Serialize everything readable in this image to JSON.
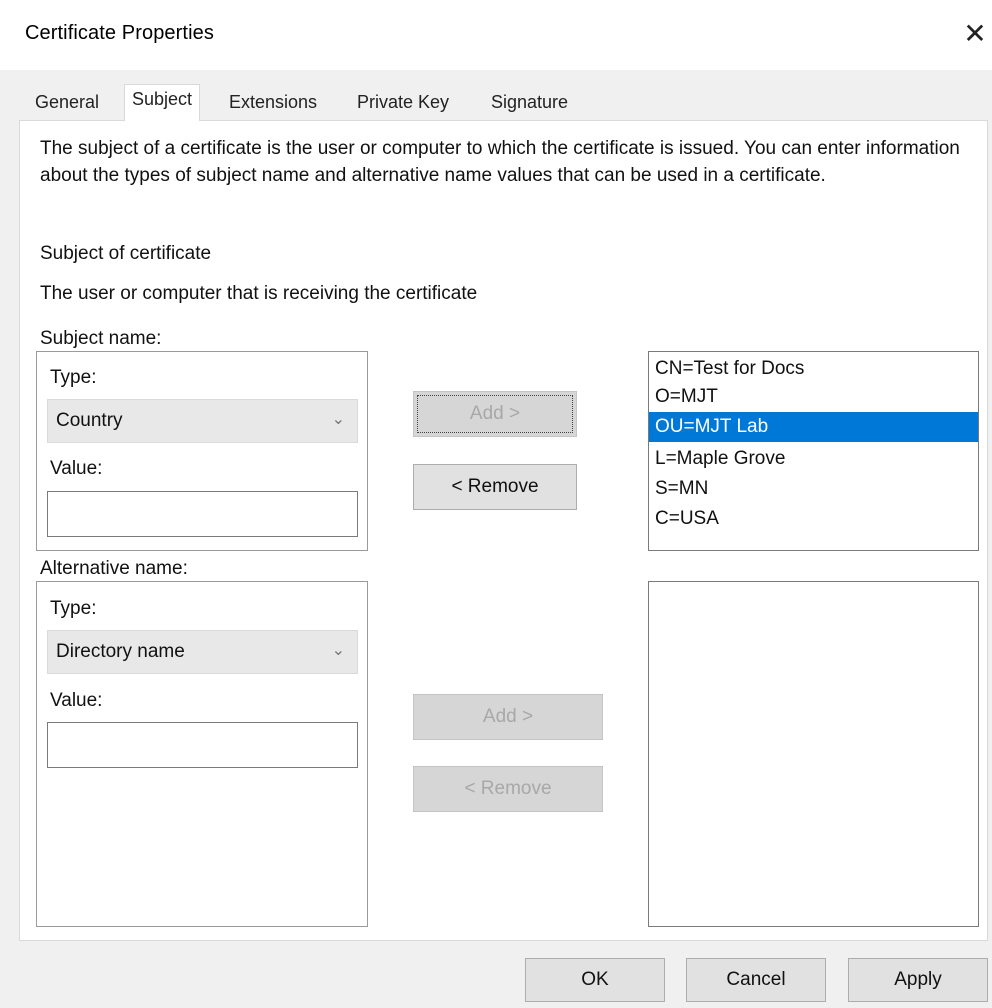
{
  "window": {
    "title": "Certificate Properties",
    "close_glyph": "✕"
  },
  "tabs": [
    {
      "label": "General"
    },
    {
      "label": "Subject",
      "active": true
    },
    {
      "label": "Extensions"
    },
    {
      "label": "Private Key"
    },
    {
      "label": "Signature"
    }
  ],
  "description": "The subject of a certificate is the user or computer to which the certificate is issued. You can enter information about the types of subject name and alternative name values that can be used in a certificate.",
  "subject_section": {
    "heading": "Subject of certificate",
    "subheading": "The user or computer that is receiving the certificate"
  },
  "subject_name": {
    "label": "Subject name:",
    "type_label": "Type:",
    "type_value": "Country",
    "value_label": "Value:",
    "value": "",
    "add_label": "Add >",
    "remove_label": "< Remove",
    "list": [
      {
        "text": "CN=Test for Docs"
      },
      {
        "text": "O=MJT"
      },
      {
        "text": "OU=MJT Lab",
        "selected": true
      },
      {
        "text": "L=Maple Grove"
      },
      {
        "text": "S=MN"
      },
      {
        "text": "C=USA"
      }
    ]
  },
  "alternative_name": {
    "label": "Alternative name:",
    "type_label": "Type:",
    "type_value": "Directory name",
    "value_label": "Value:",
    "value": "",
    "add_label": "Add >",
    "remove_label": "< Remove",
    "list": []
  },
  "footer": {
    "ok_label": "OK",
    "cancel_label": "Cancel",
    "apply_label": "Apply"
  },
  "colors": {
    "selection": "#0078d7",
    "dialog_bg": "#f0f0f0"
  }
}
